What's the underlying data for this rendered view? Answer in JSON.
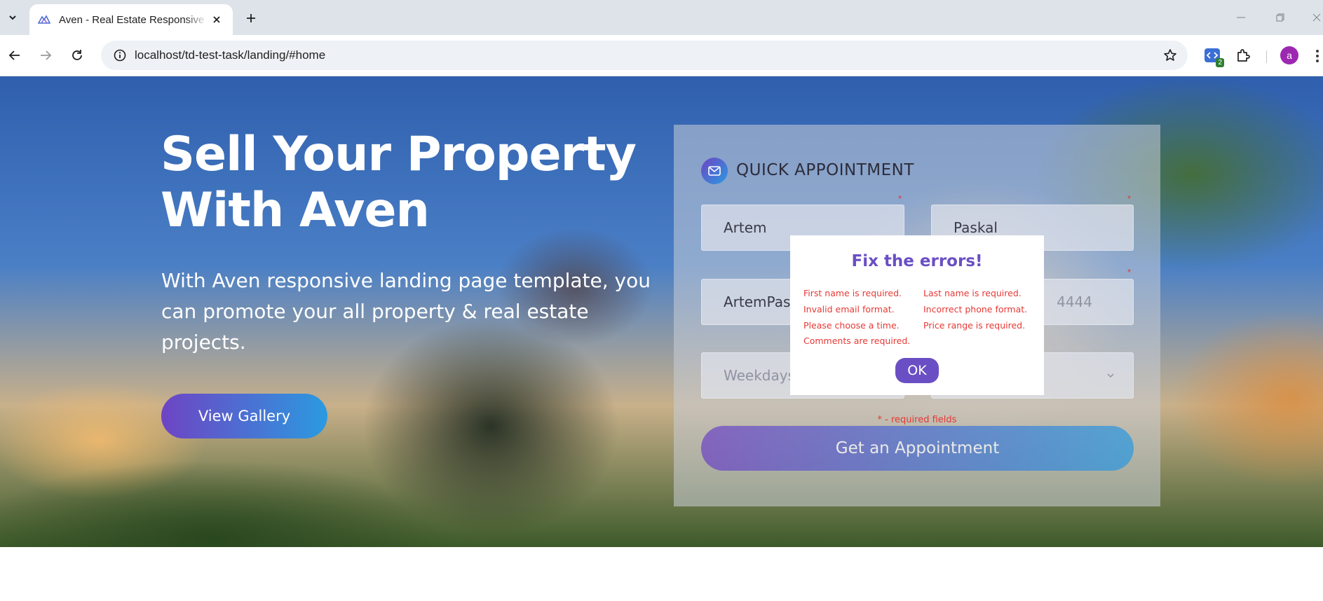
{
  "browser": {
    "tab_title": "Aven - Real Estate Responsive HTML",
    "url": "localhost/td-test-task/landing/#home",
    "extension_badge": "2",
    "profile_initial": "a"
  },
  "hero": {
    "title": "Sell Your Property With Aven",
    "subtitle": "With Aven responsive landing page template, you can promote your all property & real estate projects.",
    "gallery_button": "View Gallery"
  },
  "appointment": {
    "title": "QUICK APPOINTMENT",
    "first_name_value": "Artem",
    "last_name_value": "Paskal",
    "email_value": "ArtemPas",
    "phone_placeholder": "4444",
    "time_placeholder": "Weekdays",
    "required_star": "*",
    "required_note": "* - required fields",
    "submit_button": "Get an Appointment"
  },
  "dialog": {
    "title": "Fix the errors!",
    "errors_left": [
      "First name is required.",
      "Invalid email format.",
      "Please choose a time.",
      "Comments are required."
    ],
    "errors_right": [
      "Last name is required.",
      "Incorrect phone format.",
      "Price range is required."
    ],
    "ok_button": "OK"
  },
  "colors": {
    "accent_purple": "#6a4fc4",
    "accent_blue": "#2b9ae0",
    "error_red": "#e53935"
  }
}
